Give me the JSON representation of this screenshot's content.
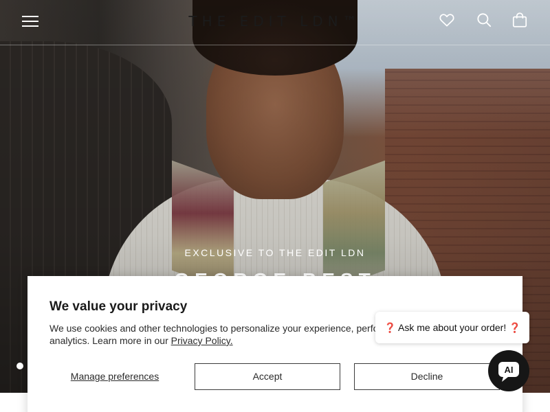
{
  "header": {
    "logo": "THE EDIT LDN™",
    "menu_icon": "hamburger-menu-icon",
    "wishlist_icon": "heart-icon",
    "search_icon": "search-icon",
    "cart_icon": "shopping-bag-icon"
  },
  "hero": {
    "eyebrow": "EXCLUSIVE TO THE EDIT LDN",
    "title": "GEORGE BEST",
    "active_slide": 1
  },
  "cookie_banner": {
    "heading": "We value your privacy",
    "body": "We use cookies and other technologies to personalize your experience, perform marketing, and collect analytics. Learn more in our",
    "policy_link": "Privacy Policy.",
    "manage_label": "Manage preferences",
    "accept_label": "Accept",
    "decline_label": "Decline"
  },
  "chat": {
    "prompt": "❓ Ask me about your order! ❓",
    "launcher_label": "AI"
  }
}
